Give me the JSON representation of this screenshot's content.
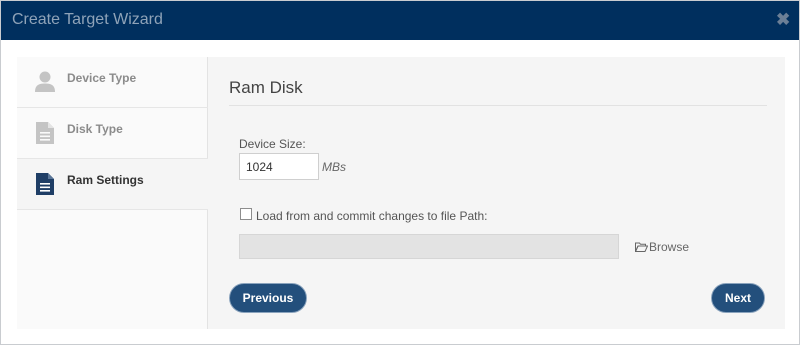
{
  "dialog": {
    "title": "Create Target Wizard",
    "close_symbol": "✖"
  },
  "nav": {
    "items": [
      {
        "label": "Device Type",
        "icon": "user-icon",
        "active": false
      },
      {
        "label": "Disk Type",
        "icon": "document-icon",
        "active": false
      },
      {
        "label": "Ram Settings",
        "icon": "document-icon",
        "active": true
      }
    ]
  },
  "content": {
    "section_title": "Ram Disk",
    "device_size_label": "Device Size:",
    "device_size_value": "1024",
    "device_size_unit": "MBs",
    "load_checkbox_label": "Load from and commit changes to file Path:",
    "load_checkbox_checked": false,
    "file_path_value": "",
    "browse_label": "Browse"
  },
  "buttons": {
    "previous_label": "Previous",
    "next_label": "Next"
  },
  "colors": {
    "titlebar": "#002f5e",
    "button": "#234f7c"
  }
}
